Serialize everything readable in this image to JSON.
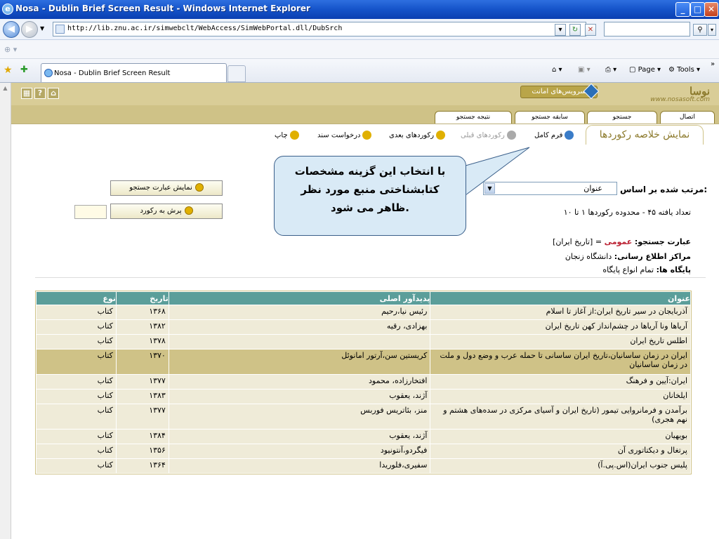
{
  "window": {
    "title": "Nosa - Dublin Brief Screen Result - Windows Internet Explorer"
  },
  "browser": {
    "url": "http://lib.znu.ac.ir/simwebclt/WebAccess/SimWebPortal.dll/DubSrch",
    "tab_title": "Nosa - Dublin Brief Screen Result",
    "page_menu": "Page",
    "tools_menu": "Tools"
  },
  "site": {
    "service_label": "سرویس‌های امانت",
    "logo_name": "نوسا",
    "logo_url": "www.nosasoft.com"
  },
  "nav_tabs": [
    "اتصال",
    "جستجو",
    "سابقه جستجو",
    "نتیجه جستجو"
  ],
  "page_tab": "نمایش خلاصه رکوردها",
  "toolbar": {
    "full_form": "فرم کامل",
    "prev": "رکوردهای قبلی",
    "next": "رکوردهای بعدی",
    "request": "درخواست سند",
    "print": "چاپ"
  },
  "callout": {
    "line1": "با انتخاب این گزینه مشخصات",
    "line2": "کتابشناختی منبع مورد نظر",
    "line3": "ظاهر می شود."
  },
  "sort": {
    "label": "مرتب شده بر اساس:",
    "value": "عنوان"
  },
  "results_info": "تعداد یافته ۴۵ - محدوده رکوردها ۱ تا ۱۰",
  "query": {
    "label": "عبارت جستجو:",
    "field": "عمومی",
    "rest": "= [تاریخ ایران]"
  },
  "centers": {
    "label": "مراکز اطلاع رسانی:",
    "value": "دانشگاه زنجان"
  },
  "bases": {
    "label": "پایگاه ها:",
    "value": "تمام انواع پایگاه"
  },
  "buttons": {
    "show_query": "نمایش عبارت جستجو",
    "jump": "پرش به رکورد"
  },
  "table": {
    "headers": [
      "عنوان",
      "پدیدآور اصلی",
      "تاریخ",
      "نوع"
    ],
    "rows": [
      [
        "آذربایجان در سیر تاریخ ایران:از آغاز تا اسلام",
        "رئیس نیا،رحیم",
        "۱۳۶۸",
        "کتاب"
      ],
      [
        "آریاها ونا آریاها در چشم‌انداز کهن تاریخ ایران",
        "بهزادی، رقیه",
        "۱۳۸۲",
        "کتاب"
      ],
      [
        "اطلس تاریخ ایران",
        "",
        "۱۳۷۸",
        "کتاب"
      ],
      [
        "ایران در زمان ساسانیان،تاریخ ایران ساسانی تا حمله عرب و وضع دول و ملت در زمان ساسانیان",
        "کریستین سن،آرتور امانوئل",
        "۱۳۷۰",
        "کتاب"
      ],
      [
        "ایران:آیین و فرهنگ",
        "افتخارزاده، محمود",
        "۱۳۷۷",
        "کتاب"
      ],
      [
        "ایلخانان",
        "آژند، یعقوب",
        "۱۳۸۳",
        "کتاب"
      ],
      [
        "برآمدن و فرمانروایی تیمور (تاریخ ایران و آسیای مرکزی در سده‌های هشتم و نهم هجری)",
        "منز، بئاتریس فوربس",
        "۱۳۷۷",
        "کتاب"
      ],
      [
        "بویهیان",
        "آژند، یعقوب",
        "۱۳۸۴",
        "کتاب"
      ],
      [
        "پرتغال و دیکتاتوری آن",
        "فیگردو،آنتونیود",
        "۱۳۵۶",
        "کتاب"
      ],
      [
        "پلیس جنوب ایران(اس.پی.آ)",
        "سفیری،فلوریدا",
        "۱۳۶۴",
        "کتاب"
      ]
    ]
  }
}
